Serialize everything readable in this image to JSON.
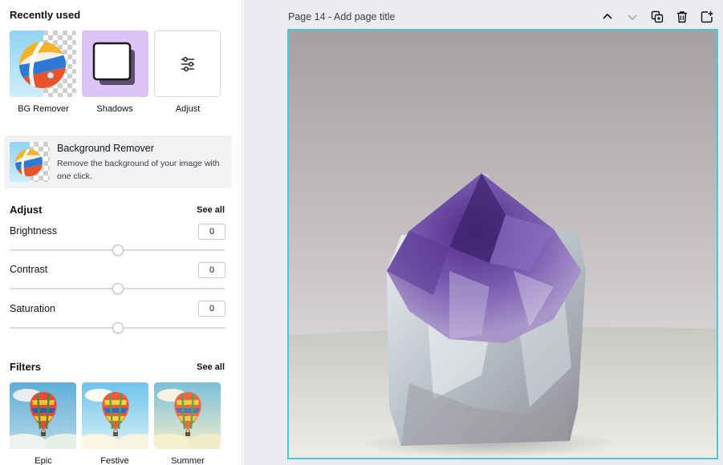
{
  "panel": {
    "recently_used": {
      "title": "Recently used",
      "items": [
        {
          "label": "BG Remover",
          "icon": "beach-ball-icon"
        },
        {
          "label": "Shadows",
          "icon": "shadow-square-icon"
        },
        {
          "label": "Adjust",
          "icon": "sliders-icon"
        }
      ]
    },
    "bg_remover_card": {
      "title": "Background Remover",
      "description": "Remove the background of your image with one click."
    },
    "adjust": {
      "title": "Adjust",
      "see_all": "See all",
      "controls": [
        {
          "label": "Brightness",
          "value": "0",
          "level": 0.5
        },
        {
          "label": "Contrast",
          "value": "0",
          "level": 0.5
        },
        {
          "label": "Saturation",
          "value": "0",
          "level": 0.5
        }
      ]
    },
    "filters": {
      "title": "Filters",
      "see_all": "See all",
      "items": [
        {
          "label": "Epic"
        },
        {
          "label": "Festive"
        },
        {
          "label": "Summer"
        }
      ]
    }
  },
  "workspace": {
    "page_title": "Page 14 - Add page title",
    "toolbar": [
      {
        "name": "move-page-up",
        "icon": "chevron-up-icon"
      },
      {
        "name": "move-page-down",
        "icon": "chevron-down-icon"
      },
      {
        "name": "duplicate-page",
        "icon": "duplicate-icon"
      },
      {
        "name": "delete-page",
        "icon": "trash-icon"
      },
      {
        "name": "add-page",
        "icon": "add-page-icon"
      }
    ]
  },
  "colors": {
    "selection_border": "#49c9d4",
    "shadows_tile_bg": "#dcc4f7",
    "card_bg": "#f1f2f4",
    "workspace_bg": "#ebecf0"
  }
}
